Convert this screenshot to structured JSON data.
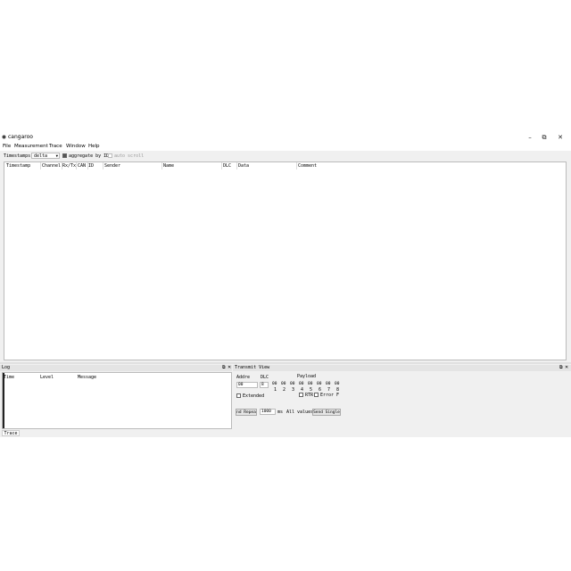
{
  "window": {
    "title": "cangaroo",
    "minimize": "–",
    "maximize": "⧉",
    "close": "✕"
  },
  "menu": [
    "File",
    "Measurement",
    "Trace",
    "Window",
    "Help"
  ],
  "toolbar": {
    "timestamps_label": "Timestamps:",
    "timestamps_value": "delta",
    "aggregate_label": "aggregate by ID",
    "aggregate_checked": true,
    "autoscroll_label": "auto scroll"
  },
  "trace_columns": [
    "Timestamp",
    "Channel",
    "Rx/Tx",
    "CAN",
    "ID",
    "Sender",
    "Name",
    "DLC",
    "Data",
    "Comment"
  ],
  "log": {
    "title": "Log",
    "columns": [
      "Time",
      "Level",
      "Message"
    ]
  },
  "transmit": {
    "title": "Transmit View",
    "address_label": "Addre",
    "dlc_label": "DLC",
    "payload_label": "Payload",
    "address_value": "00",
    "dlc_value": "8",
    "payload": [
      "00",
      "00",
      "00",
      "00",
      "00",
      "00",
      "00",
      "00"
    ],
    "digits": [
      "1",
      "2",
      "3",
      "4",
      "5",
      "6",
      "7",
      "8"
    ],
    "extended_label": "Extended",
    "rtr_label": "RTR",
    "error_label": "Error F",
    "repeat_label": "nd Repea",
    "repeat_value": "1000",
    "ms_label": "ms",
    "all_values_label": "All values",
    "send_single_label": "Send Single"
  },
  "bottom_tab": "Trace",
  "dock_controls": {
    "float": "⧉",
    "close": "✕"
  }
}
